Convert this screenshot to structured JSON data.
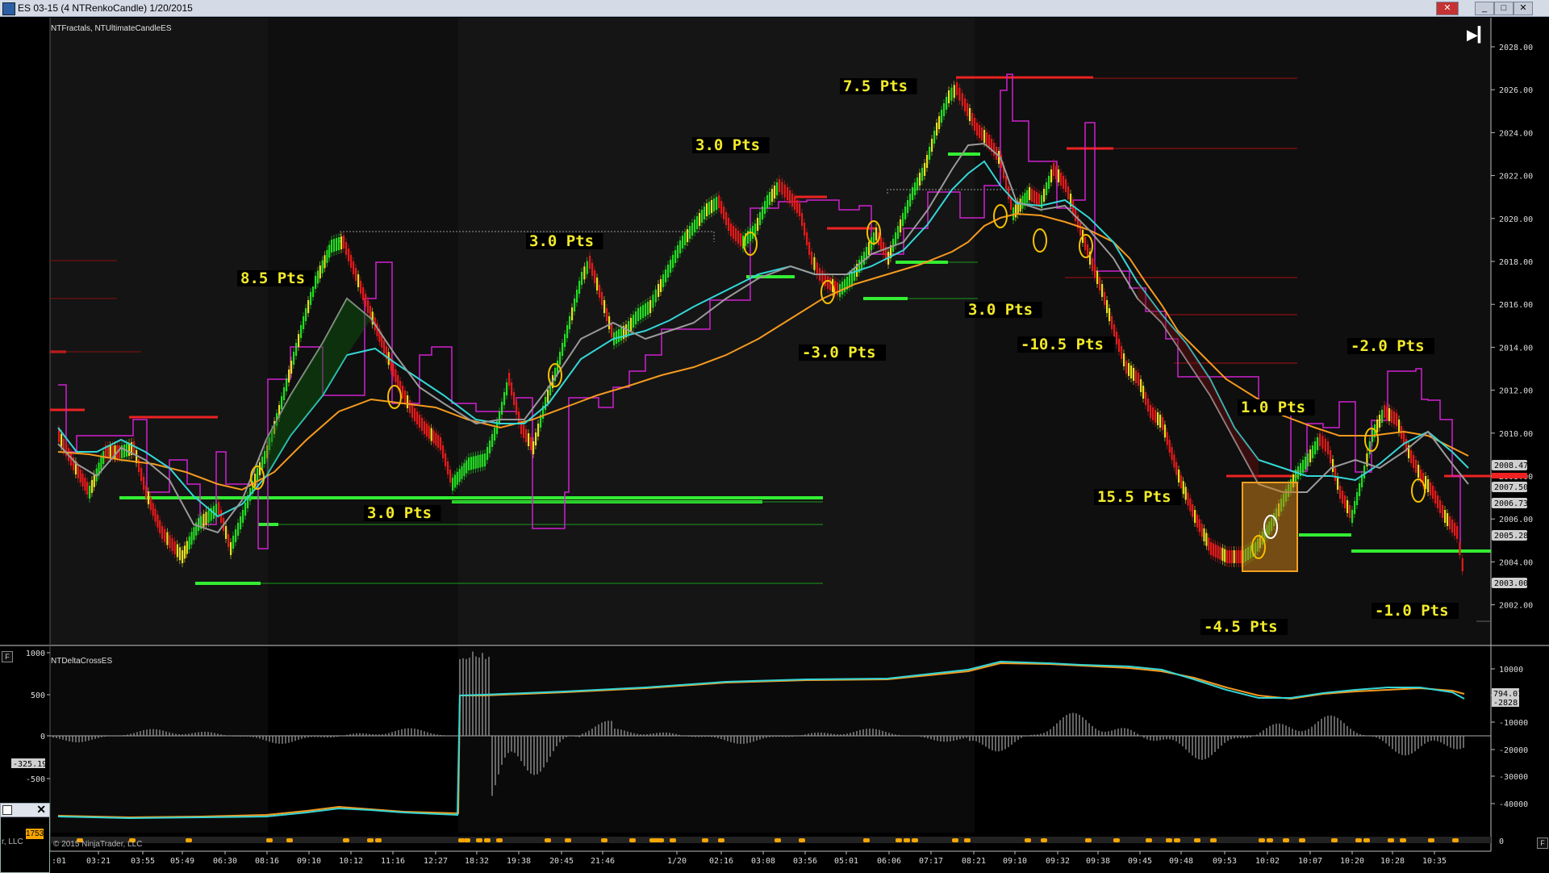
{
  "window": {
    "title": "ES 03-15 (4 NTRenkoCandle)  1/20/2015",
    "buttons": {
      "close": "✕",
      "minimize": "_",
      "maximize": "□"
    }
  },
  "price_panel": {
    "indicator_label": "NTFractals, NTUltimateCandleES",
    "y_ticks": [
      "2028.00",
      "2026.00",
      "2024.00",
      "2022.00",
      "2020.00",
      "2018.00",
      "2016.00",
      "2014.00",
      "2012.00",
      "2010.00",
      "2008.00",
      "2006.00",
      "2004.00",
      "2002.00"
    ],
    "price_tags": [
      {
        "text": "2008.47",
        "fill": "#cfcfcf",
        "color": "#000"
      },
      {
        "text": "2007.50",
        "fill": "#cfcfcf",
        "color": "#000"
      },
      {
        "text": "2006.73",
        "fill": "#cfcfcf",
        "color": "#000"
      },
      {
        "text": "2005.28",
        "fill": "#cfcfcf",
        "color": "#000"
      },
      {
        "text": "2003.00",
        "fill": "#cfcfcf",
        "color": "#000"
      }
    ],
    "annotations": [
      "8.5 Pts",
      "3.0 Pts",
      "3.0 Pts",
      "3.0 Pts",
      "7.5 Pts",
      "-3.0 Pts",
      "3.0 Pts",
      "-10.5 Pts",
      "1.0 Pts",
      "-2.0 Pts",
      "15.5 Pts",
      "-4.5 Pts",
      "-1.0 Pts"
    ]
  },
  "lower_panel": {
    "indicator_label": "NTDeltaCrossES",
    "left_ticks": [
      "1000",
      "500",
      "0",
      "-500"
    ],
    "left_tag": "-325.19",
    "right_ticks": [
      "10000",
      "0",
      "-10000",
      "-20000",
      "-30000",
      "-40000"
    ],
    "right_tags": [
      "794.01",
      "-2828"
    ]
  },
  "time_axis": [
    "03:21",
    "03:55",
    "05:49",
    "06:30",
    "08:16",
    "09:10",
    "10:12",
    "11:16",
    "12:27",
    "18:32",
    "19:38",
    "20:45",
    "21:46",
    "1/20",
    "02:16",
    "03:08",
    "03:56",
    "05:01",
    "06:06",
    "07:17",
    "08:21",
    "09:10",
    "09:32",
    "09:38",
    "09:45",
    "09:48",
    "09:53",
    "10:02",
    "10:07",
    "10:20",
    "10:28",
    "10:35"
  ],
  "time_axis_first": ":01",
  "footer": {
    "copyright": "© 2015 NinjaTrader, LLC",
    "popup_count": "1753",
    "popup_text": "r, LLC"
  },
  "colors": {
    "up": "#22dd22",
    "down": "#e61a1a",
    "neutral": "#e8e020",
    "fast_ma": "#35d6d6",
    "slow_ma": "#f59a1e",
    "mid_ma": "#9a9a9a",
    "fractal": "#d020d0",
    "support": "#33ee33",
    "resistance": "#ee2222",
    "label": "#f2ea2a"
  }
}
